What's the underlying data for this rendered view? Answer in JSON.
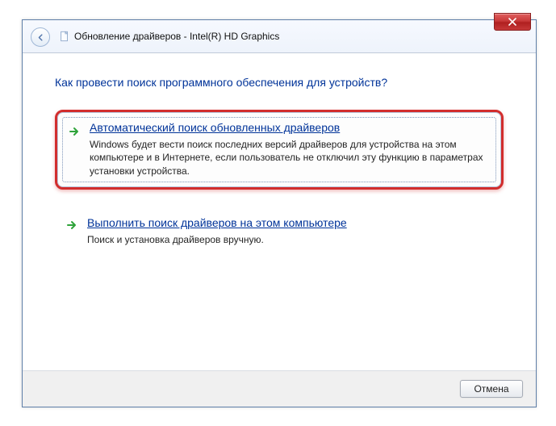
{
  "window": {
    "title": "Обновление драйверов - Intel(R) HD Graphics"
  },
  "heading": "Как провести поиск программного обеспечения для устройств?",
  "options": {
    "auto": {
      "title": "Автоматический поиск обновленных драйверов",
      "desc": "Windows будет вести поиск последних версий драйверов для устройства на этом компьютере и в Интернете, если пользователь не отключил эту функцию в параметрах установки устройства."
    },
    "manual": {
      "title": "Выполнить поиск драйверов на этом компьютере",
      "desc": "Поиск и установка драйверов вручную."
    }
  },
  "footer": {
    "cancel": "Отмена"
  }
}
